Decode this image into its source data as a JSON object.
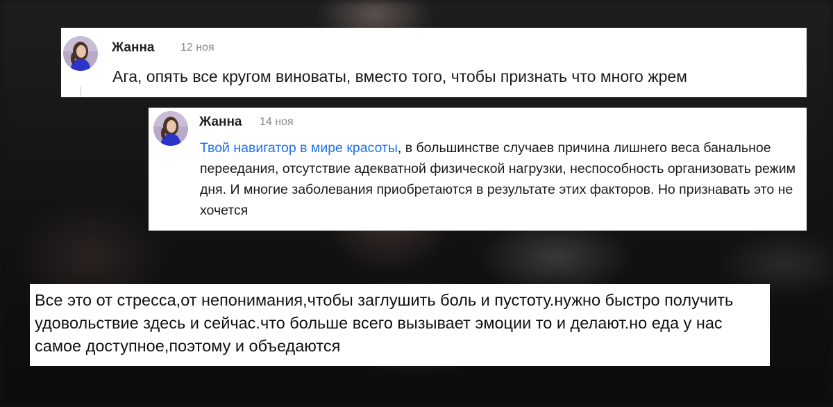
{
  "comments": [
    {
      "author": "Жанна",
      "date": "12 ноя",
      "text": "Ага, опять все кругом виноваты, вместо того, чтобы признать что много жрем"
    },
    {
      "author": "Жанна",
      "date": "14 ноя",
      "mention": "Твой навигатор в мире красоты",
      "text": ", в большинстве случаев причина лишнего веса банальное переедания, отсутствие адекватной физической нагрузки, неспособность организовать режим дня. И многие заболевания приобретаются в результате этих факторов. Но признавать это не хочется"
    },
    {
      "text": "Все это от стресса,от непонимания,чтобы заглушить боль и пустоту.нужно быстро получить удовольствие здесь и сейчас.что больше всего вызывает эмоции то и делают.но еда у нас самое доступное,поэтому и объедаются"
    }
  ],
  "colors": {
    "mention": "#1a73e8",
    "date": "#888888",
    "author": "#222222",
    "card_background": "#ffffff"
  },
  "icons": {
    "avatar": "user-avatar-photo"
  }
}
